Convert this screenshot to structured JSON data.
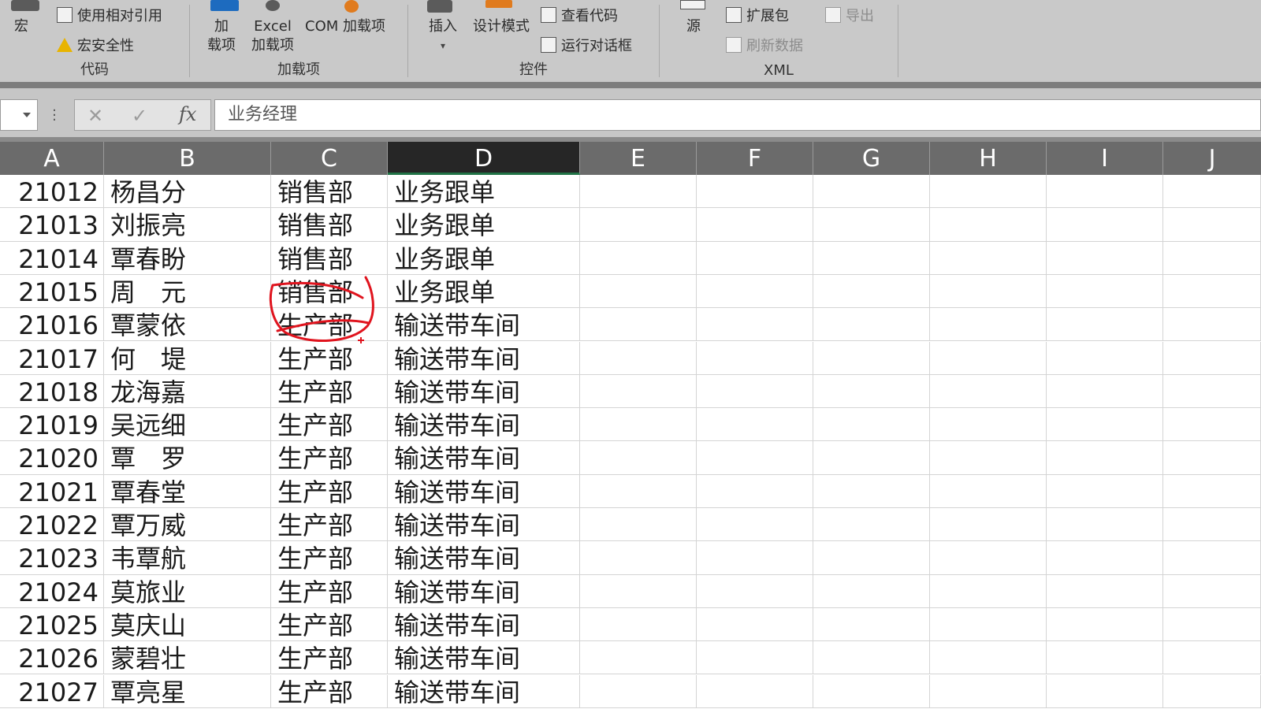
{
  "ribbon": {
    "groups": [
      {
        "label": "代码"
      },
      {
        "label": "加载项"
      },
      {
        "label": "控件"
      },
      {
        "label": "XML"
      }
    ],
    "macros_label": "宏",
    "use_relative_ref": "使用相对引用",
    "macro_security": "宏安全性",
    "addins_line1": "加",
    "addins_line2": "载项",
    "excel_addins_line1": "Excel",
    "excel_addins_line2": "加载项",
    "com_addins": "COM 加载项",
    "insert_label": "插入",
    "design_mode": "设计模式",
    "view_code": "查看代码",
    "run_dialog": "运行对话框",
    "source_label": "源",
    "expansion_packs": "扩展包",
    "export_label": "导出",
    "refresh_data": "刷新数据"
  },
  "formula_bar": {
    "fx": "fx",
    "value": "业务经理"
  },
  "columns": [
    "A",
    "B",
    "C",
    "D",
    "E",
    "F",
    "G",
    "H",
    "I",
    "J"
  ],
  "active_column": "D",
  "rows": [
    [
      "21012",
      "杨昌分",
      "销售部",
      "业务跟单"
    ],
    [
      "21013",
      "刘振亮",
      "销售部",
      "业务跟单"
    ],
    [
      "21014",
      "覃春盼",
      "销售部",
      "业务跟单"
    ],
    [
      "21015",
      "周　元",
      "销售部",
      "业务跟单"
    ],
    [
      "21016",
      "覃蒙依",
      "生产部",
      "输送带车间"
    ],
    [
      "21017",
      "何　堤",
      "生产部",
      "输送带车间"
    ],
    [
      "21018",
      "龙海嘉",
      "生产部",
      "输送带车间"
    ],
    [
      "21019",
      "吴远细",
      "生产部",
      "输送带车间"
    ],
    [
      "21020",
      "覃　罗",
      "生产部",
      "输送带车间"
    ],
    [
      "21021",
      "覃春堂",
      "生产部",
      "输送带车间"
    ],
    [
      "21022",
      "覃万威",
      "生产部",
      "输送带车间"
    ],
    [
      "21023",
      "韦覃航",
      "生产部",
      "输送带车间"
    ],
    [
      "21024",
      "莫旅业",
      "生产部",
      "输送带车间"
    ],
    [
      "21025",
      "莫庆山",
      "生产部",
      "输送带车间"
    ],
    [
      "21026",
      "蒙碧壮",
      "生产部",
      "输送带车间"
    ],
    [
      "21027",
      "覃亮星",
      "生产部",
      "输送带车间"
    ]
  ],
  "colors": {
    "ribbon_bg": "#c9c9c9",
    "header_bg": "#6b6b6b",
    "active_header": "#262626",
    "annotation": "#e0141e"
  }
}
